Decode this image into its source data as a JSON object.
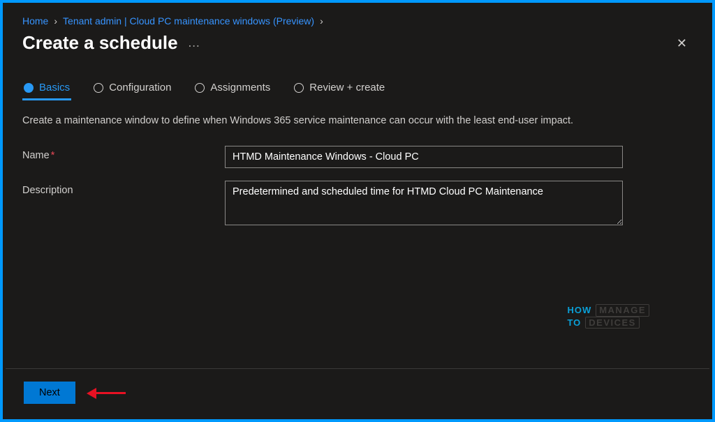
{
  "breadcrumb": {
    "home": "Home",
    "tenant": "Tenant admin | Cloud PC maintenance windows (Preview)"
  },
  "title": "Create a schedule",
  "tabs": {
    "basics": "Basics",
    "configuration": "Configuration",
    "assignments": "Assignments",
    "review": "Review + create"
  },
  "intro": "Create a maintenance window to define when Windows 365 service maintenance can occur with the least end-user impact.",
  "form": {
    "name_label": "Name",
    "name_value": "HTMD Maintenance Windows - Cloud PC",
    "description_label": "Description",
    "description_value": "Predetermined and scheduled time for HTMD Cloud PC Maintenance"
  },
  "footer": {
    "next": "Next"
  },
  "watermark": {
    "how": "HOW",
    "to": "TO",
    "manage": "MANAGE",
    "devices": "DEVICES"
  }
}
